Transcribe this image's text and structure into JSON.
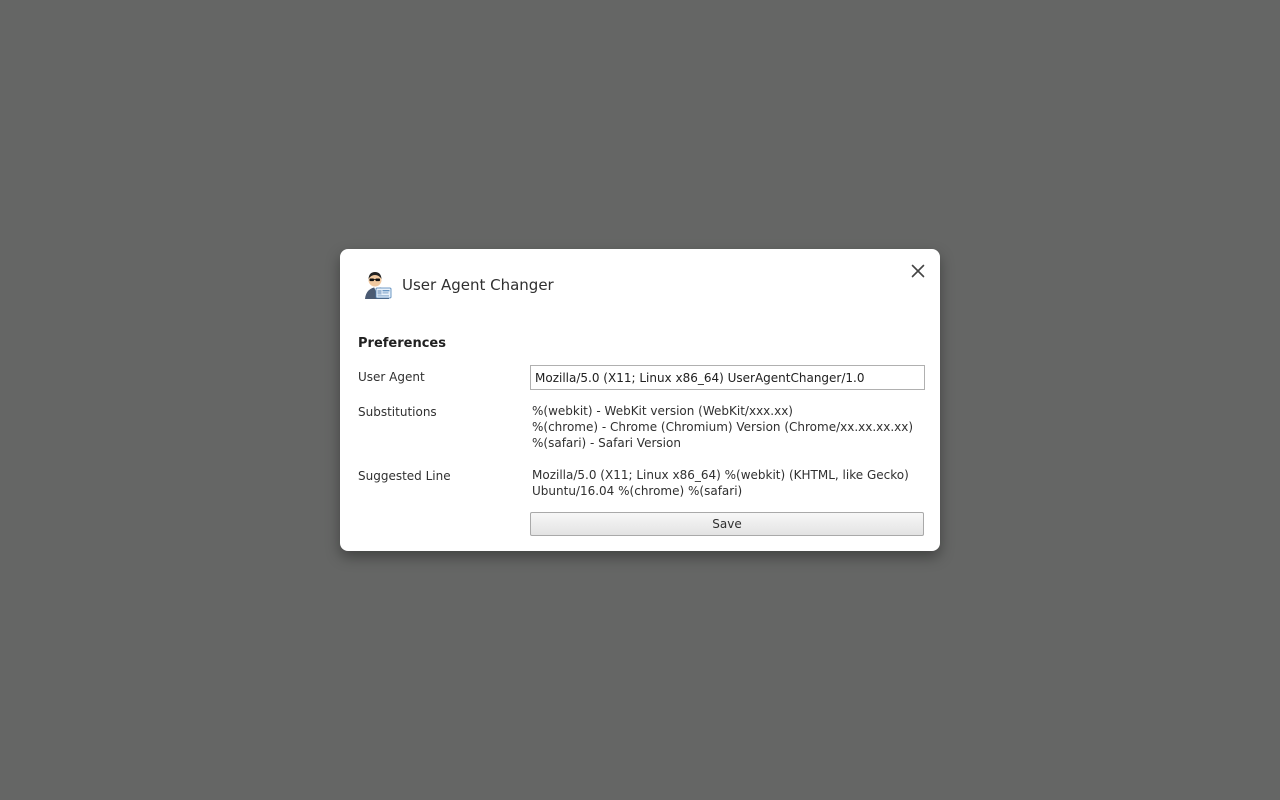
{
  "dialog": {
    "title": "User Agent Changer",
    "icon": "agent-avatar-icon",
    "close_icon": "close-icon"
  },
  "preferences": {
    "heading": "Preferences",
    "user_agent": {
      "label": "User Agent",
      "value": "Mozilla/5.0 (X11; Linux x86_64) UserAgentChanger/1.0"
    },
    "substitutions": {
      "label": "Substitutions",
      "lines": [
        "%(webkit) - WebKit version (WebKit/xxx.xx)",
        "%(chrome) - Chrome (Chromium) Version (Chrome/xx.xx.xx.xx)",
        "%(safari) - Safari Version"
      ]
    },
    "suggested_line": {
      "label": "Suggested Line",
      "lines": [
        "Mozilla/5.0 (X11; Linux x86_64) %(webkit) (KHTML, like Gecko)",
        "Ubuntu/16.04 %(chrome) %(safari)"
      ]
    },
    "save_label": "Save"
  },
  "colors": {
    "backdrop": "#656665",
    "dialog_bg": "#ffffff"
  }
}
